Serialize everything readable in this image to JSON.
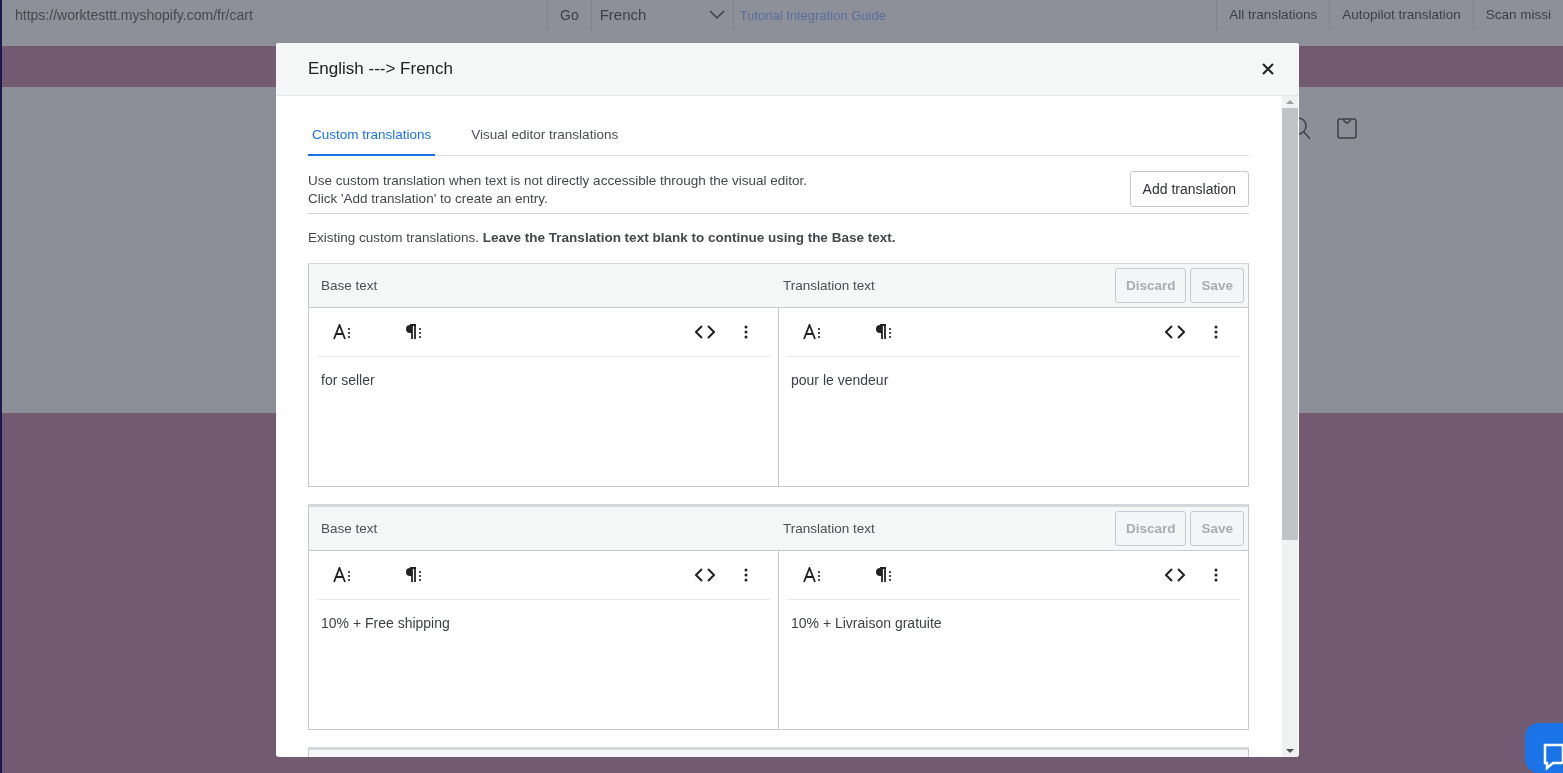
{
  "browser_bar": {
    "url": "https://worktesttt.myshopify.com/fr/cart",
    "go_button": "Go",
    "language": "French",
    "tutorial_link": "Tutorial Integration Guide",
    "actions": [
      "All translations",
      "Autopilot translation",
      "Scan missi"
    ]
  },
  "modal": {
    "title": "English ---> French",
    "tabs": [
      {
        "label": "Custom translations",
        "selected": true
      },
      {
        "label": "Visual editor translations",
        "selected": false
      }
    ],
    "info_lines": [
      "Use custom translation when text is not directly accessible through the visual editor.",
      "Click 'Add translation' to create an entry."
    ],
    "add_button": "Add translation",
    "existing_note": "Existing custom translations. **Leave the Translation text blank to continue using the Base text.**",
    "entries": [
      {
        "base_label": "Base text",
        "translation_label": "Translation text",
        "discard": "Discard",
        "save": "Save",
        "buttons_disabled": true,
        "base_text": "for seller",
        "translation_text": "pour le vendeur"
      },
      {
        "base_label": "Base text",
        "translation_label": "Translation text",
        "discard": "Discard",
        "save": "Save",
        "buttons_disabled": true,
        "base_text": "10% + Free shipping",
        "translation_text": "10% + Livraison gratuite"
      }
    ]
  }
}
